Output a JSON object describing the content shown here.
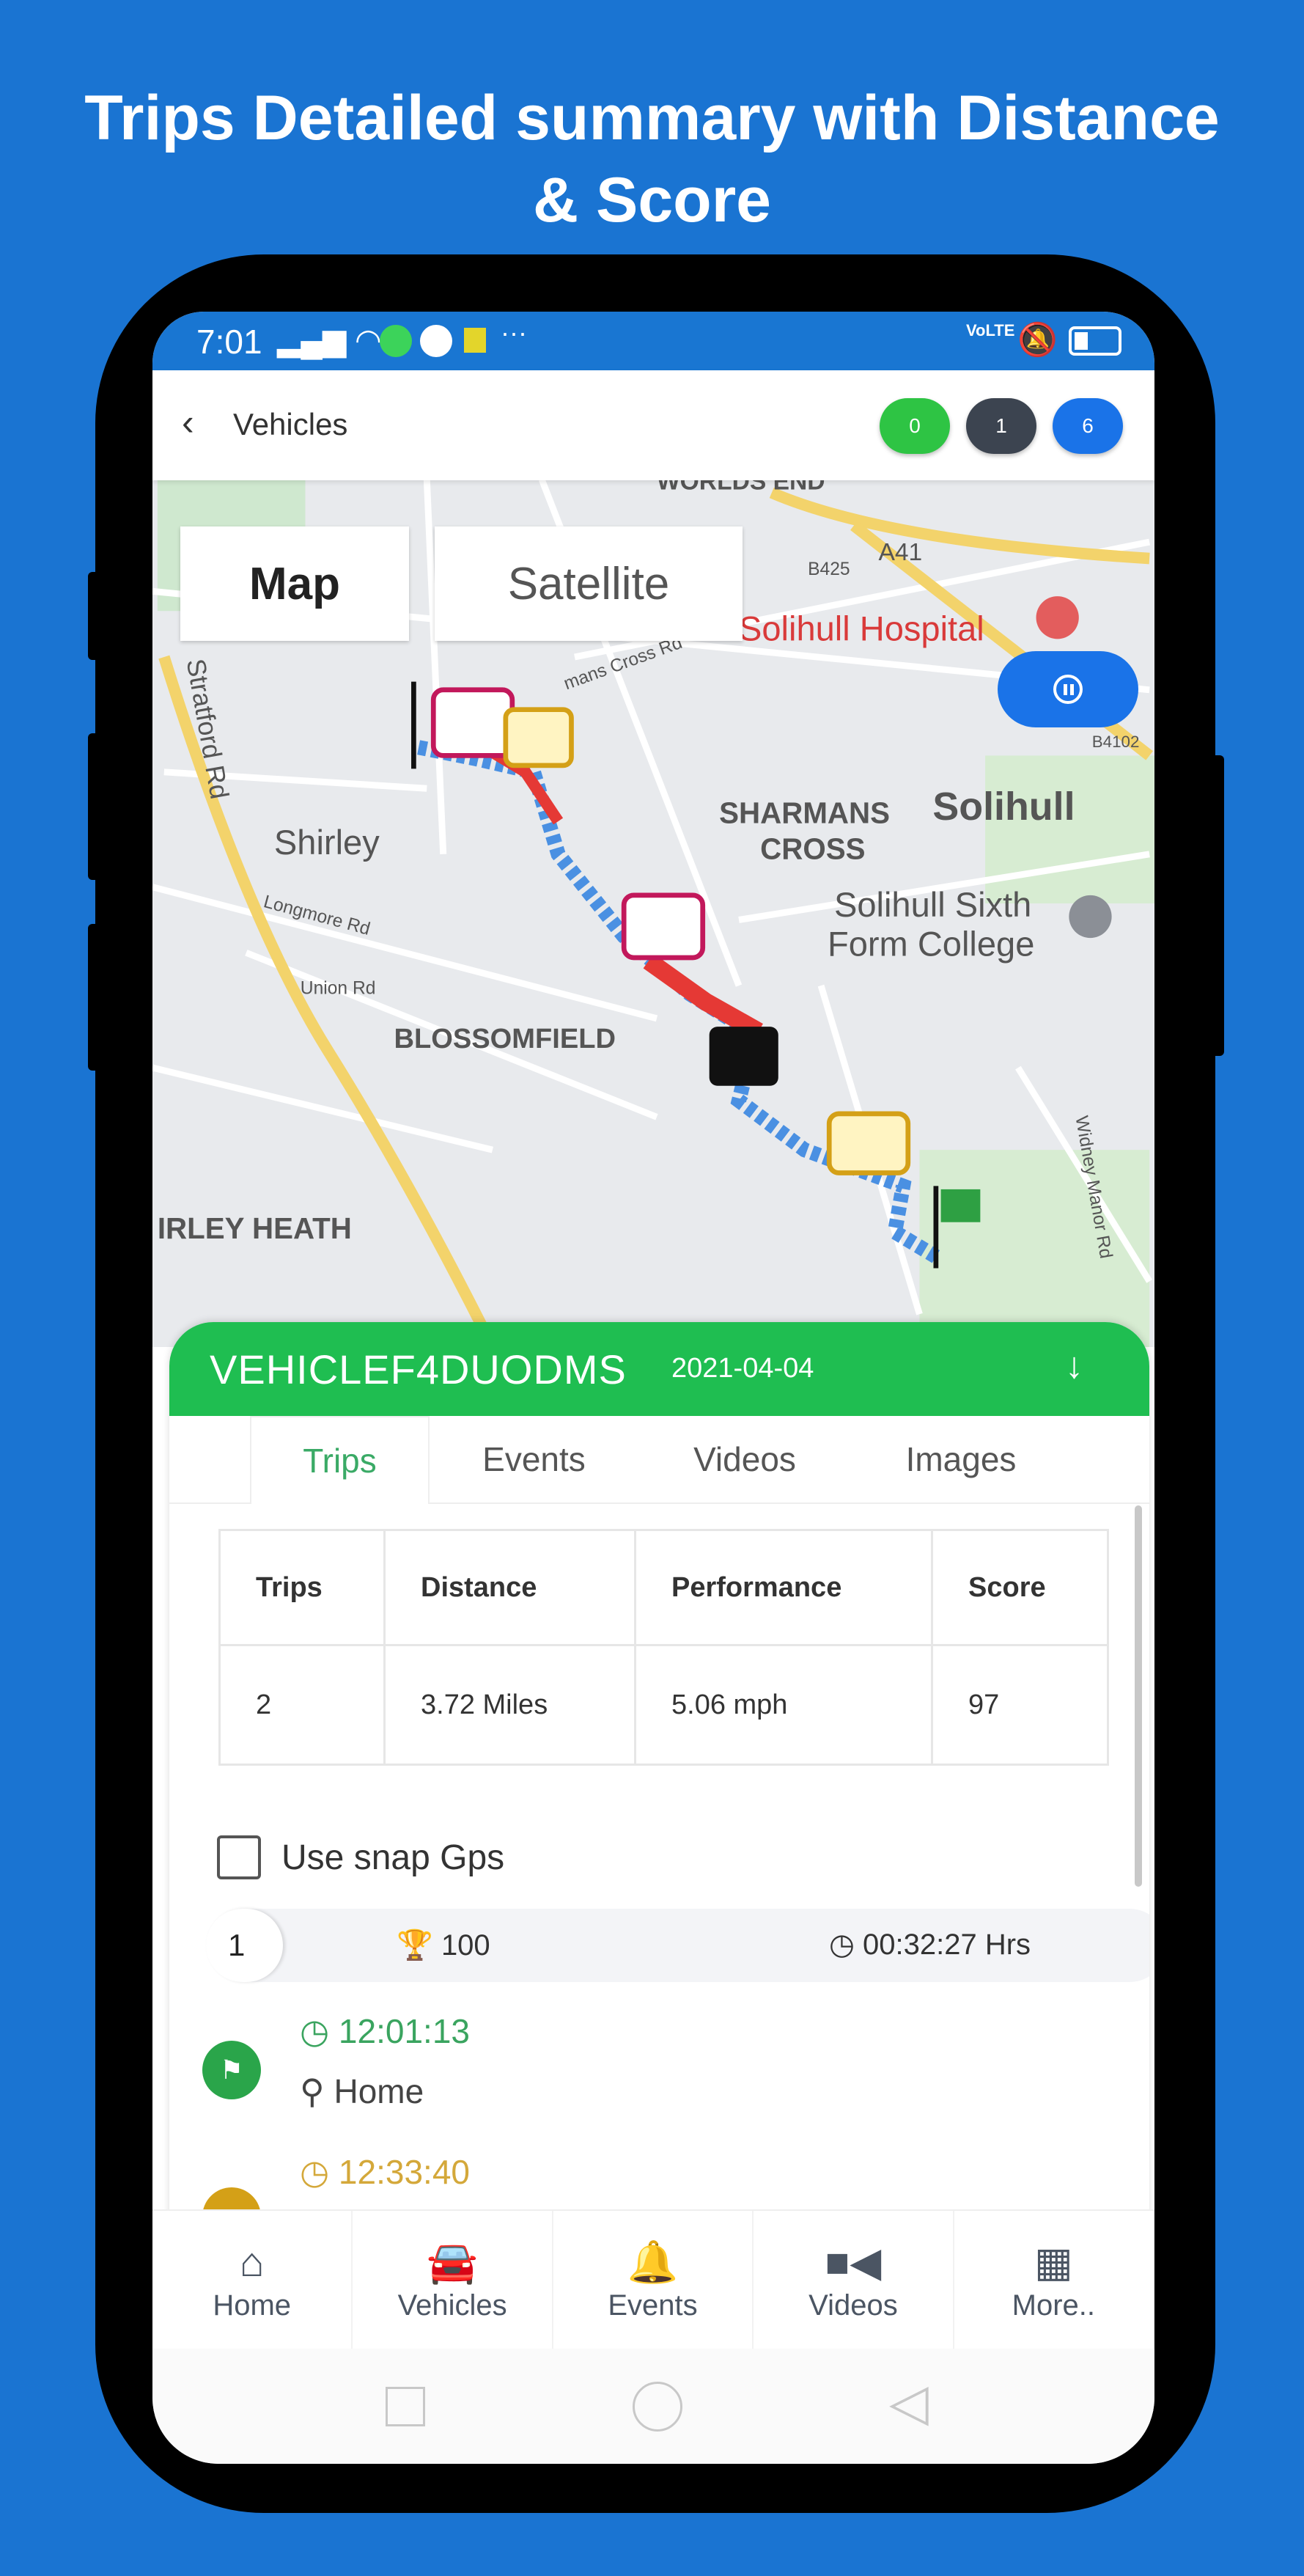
{
  "headline": {
    "line1": "Trips Detailed summary with Distance",
    "line2": "& Score"
  },
  "status_bar": {
    "time": "7:01",
    "network": "VoLTE",
    "icons": [
      "signal-icon",
      "wifi-icon",
      "whatsapp-icon",
      "app-icon",
      "notification-icon",
      "more-icon",
      "volte-icon",
      "mute-icon",
      "battery-icon"
    ]
  },
  "header": {
    "back_label": "Vehicles",
    "badges": [
      {
        "value": "0",
        "color": "#2ec444"
      },
      {
        "value": "1",
        "color": "#3c4450"
      },
      {
        "value": "6",
        "color": "#1a73e8"
      }
    ]
  },
  "map": {
    "toggle": {
      "map": "Map",
      "satellite": "Satellite",
      "selected": "Map"
    },
    "labels": {
      "worlds_end": "WORLDS END",
      "a41": "A41",
      "b425": "B425",
      "hospital": "Solihull Hospital",
      "stratford": "Stratford Rd",
      "shirley": "Shirley",
      "solihull": "Solihull",
      "sharmans": "SHARMANS",
      "cross": "CROSS",
      "sixth1": "Solihull Sixth",
      "sixth2": "Form College",
      "longmore": "Longmore Rd",
      "union": "Union Rd",
      "blossomfield": "BLOSSOMFIELD",
      "heath": "IRLEY HEATH",
      "widney": "Widney Manor Rd",
      "crossrd": "mans Cross Rd",
      "b4102": "B4102"
    },
    "colors": {
      "route": "#4a90e2",
      "speeding": "#e53935"
    }
  },
  "panel": {
    "vehicle_name": "VEHICLEF4DUODMS",
    "date": "2021-04-04",
    "tabs": [
      {
        "label": "Trips",
        "active": true
      },
      {
        "label": "Events"
      },
      {
        "label": "Videos"
      },
      {
        "label": "Images"
      }
    ],
    "summary_table": {
      "headers": [
        "Trips",
        "Distance",
        "Performance",
        "Score"
      ],
      "rows": [
        [
          "2",
          "3.72 Miles",
          "5.06 mph",
          "97"
        ]
      ]
    },
    "snap_gps": {
      "label": "Use snap Gps",
      "checked": false
    },
    "trip": {
      "number": "1",
      "score": "100",
      "duration": "00:32:27 Hrs"
    },
    "events": [
      {
        "time": "12:01:13",
        "location": "Home",
        "color": "#2aa54a",
        "icon": "flag-icon"
      },
      {
        "time": "12:33:40",
        "color": "#d4a017",
        "icon": "stop-icon"
      }
    ]
  },
  "bottom_nav": [
    {
      "label": "Home",
      "icon": "home-icon"
    },
    {
      "label": "Vehicles",
      "icon": "car-icon"
    },
    {
      "label": "Events",
      "icon": "bell-icon"
    },
    {
      "label": "Videos",
      "icon": "video-icon"
    },
    {
      "label": "More..",
      "icon": "grid-icon"
    }
  ],
  "accent": "#1fbe51",
  "background": "#1a74d2"
}
